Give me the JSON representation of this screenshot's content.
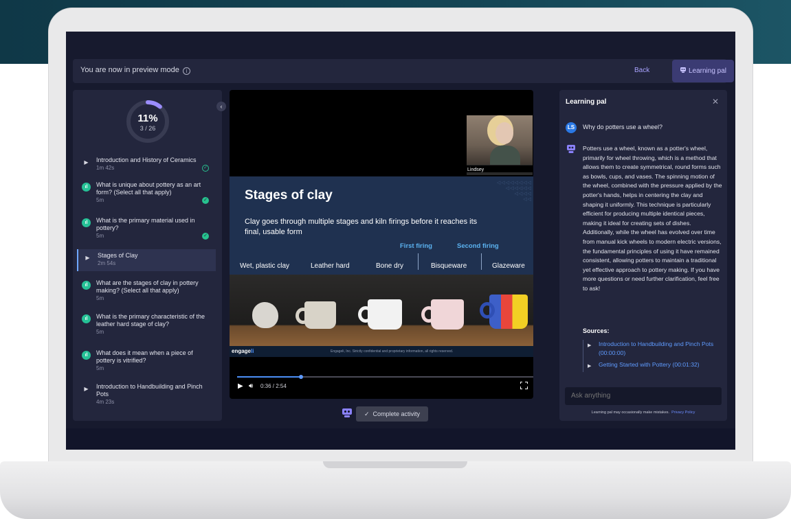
{
  "topbar": {
    "preview_text": "You are now in preview mode",
    "info_icon": "ⓘ",
    "back_label": "Back",
    "pal_label": "Learning pal"
  },
  "progress": {
    "percent_label": "11%",
    "count_label": "3 / 26",
    "value": 0.11
  },
  "lessons": [
    {
      "title": "Introduction and History of Ceramics",
      "duration": "1m 42s",
      "type": "video",
      "status": "completed-outline"
    },
    {
      "title": "What is unique about pottery as an art form? (Select all that apply)",
      "duration": "5m",
      "type": "quiz",
      "status": "completed"
    },
    {
      "title": "What is the primary material used in pottery?",
      "duration": "5m",
      "type": "quiz",
      "status": "completed"
    },
    {
      "title": "Stages of Clay",
      "duration": "2m 54s",
      "type": "video",
      "status": "active"
    },
    {
      "title": "What are the stages of clay in pottery making? (Select all that apply)",
      "duration": "5m",
      "type": "quiz",
      "status": "none"
    },
    {
      "title": "What is the primary characteristic of the leather hard stage of clay?",
      "duration": "5m",
      "type": "quiz",
      "status": "none"
    },
    {
      "title": "What does it mean when a piece of pottery is vitrified?",
      "duration": "5m",
      "type": "quiz",
      "status": "none"
    },
    {
      "title": "Introduction to Handbuilding and Pinch Pots",
      "duration": "4m 23s",
      "type": "video",
      "status": "none"
    }
  ],
  "video": {
    "presenter_name": "Lindsey",
    "slide_title": "Stages of clay",
    "slide_body": "Clay goes through multiple stages and kiln firings before it reaches its final, usable form",
    "first_firing": "First firing",
    "second_firing": "Second firing",
    "stages": [
      "Wet, plastic clay",
      "Leather hard",
      "Bone dry",
      "Bisqueware",
      "Glazeware"
    ],
    "footer_logo": "engage",
    "footer_legal": "Engageli, Inc. Strictly confidential and proprietary information, all rights reserved.",
    "time": "0:36 / 2:54",
    "progress_fraction": 0.207
  },
  "actions": {
    "complete_label": "Complete activity"
  },
  "chat": {
    "title": "Learning pal",
    "user_initials": "LS",
    "question": "Why do potters use a wheel?",
    "answer": "Potters use a wheel, known as a potter's wheel, primarily for wheel throwing, which is a method that allows them to create symmetrical, round forms such as bowls, cups, and vases. The spinning motion of the wheel, combined with the pressure applied by the potter's hands, helps in centering the clay and shaping it uniformly. This technique is particularly efficient for producing multiple identical pieces, making it ideal for creating sets of dishes. Additionally, while the wheel has evolved over time from manual kick wheels to modern electric versions, the fundamental principles of using it have remained consistent, allowing potters to maintain a traditional yet effective approach to pottery making. If you have more questions or need further clarification, feel free to ask!",
    "sources_label": "Sources:",
    "sources": [
      "Introduction to Handbuilding and Pinch Pots (00:00:00)",
      "Getting Started with Pottery (00:01:32)"
    ],
    "ask_placeholder": "Ask anything",
    "disclaimer": "Learning pal may occasionally make mistakes.",
    "privacy_label": "Privacy Policy"
  },
  "colors": {
    "accent": "#a9a3ff",
    "success": "#27c28f",
    "link": "#5f9bff",
    "quiz_icon": "#25c196"
  }
}
